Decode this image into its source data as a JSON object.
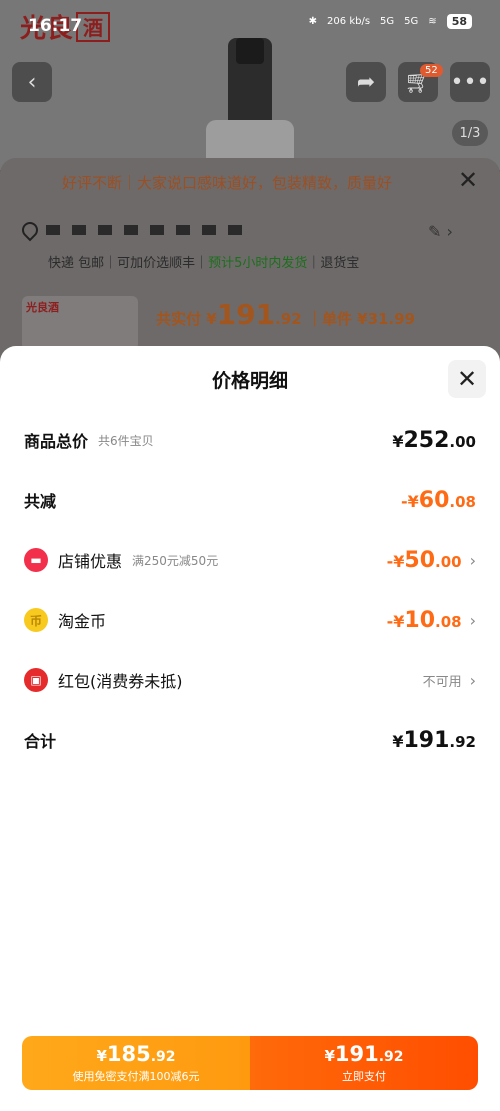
{
  "status_bar": {
    "time": "16:17",
    "network_speed": "206",
    "network_speed_unit": "kb/s",
    "sim1": "5G",
    "sim2": "5G",
    "battery": "58"
  },
  "background_page": {
    "brand": "光良",
    "brand_box": "酒",
    "image_counter": "1/3",
    "cart_badge": "52",
    "review_banner": "好评不断｜大家说口感味道好，包装精致，质量好",
    "shipping_line_a": "快递 包邮｜可加价选顺丰｜",
    "shipping_line_green": "预计5小时内发货",
    "shipping_line_b": "｜退货宝",
    "thumb_brand": "光良酒",
    "pay_label": "共实付 ¥",
    "pay_int": "191",
    "pay_dec": ".92",
    "unit_label": "｜单件 ¥31.99"
  },
  "sheet": {
    "title": "价格明细",
    "rows": [
      {
        "label": "商品总价",
        "sub": "共6件宝贝",
        "currency": "¥",
        "int": "252",
        "dec": ".00"
      },
      {
        "label": "共减",
        "currency": "-¥",
        "int": "60",
        "dec": ".08"
      },
      {
        "label": "店铺优惠",
        "sub": "满250元减50元",
        "currency": "-¥",
        "int": "50",
        "dec": ".00"
      },
      {
        "label": "淘金币",
        "currency": "-¥",
        "int": "10",
        "dec": ".08"
      },
      {
        "label": "红包(消费券未抵)",
        "status": "不可用"
      },
      {
        "label": "合计",
        "currency": "¥",
        "int": "191",
        "dec": ".92"
      }
    ]
  },
  "buttons": {
    "left": {
      "currency": "¥",
      "int": "185",
      "dec": ".92",
      "sub": "使用免密支付满100减6元"
    },
    "right": {
      "currency": "¥",
      "int": "191",
      "dec": ".92",
      "sub": "立即支付"
    }
  },
  "colors": {
    "accent_orange": "#ff6a14",
    "button_left": "#ffa81a",
    "button_right": "#ff5a05"
  },
  "icons": [
    "back-icon",
    "share-icon",
    "cart-icon",
    "more-icon",
    "close-icon",
    "location-icon",
    "edit-icon",
    "shop-icon",
    "coin-icon",
    "red-packet-icon",
    "chevron-right-icon"
  ]
}
